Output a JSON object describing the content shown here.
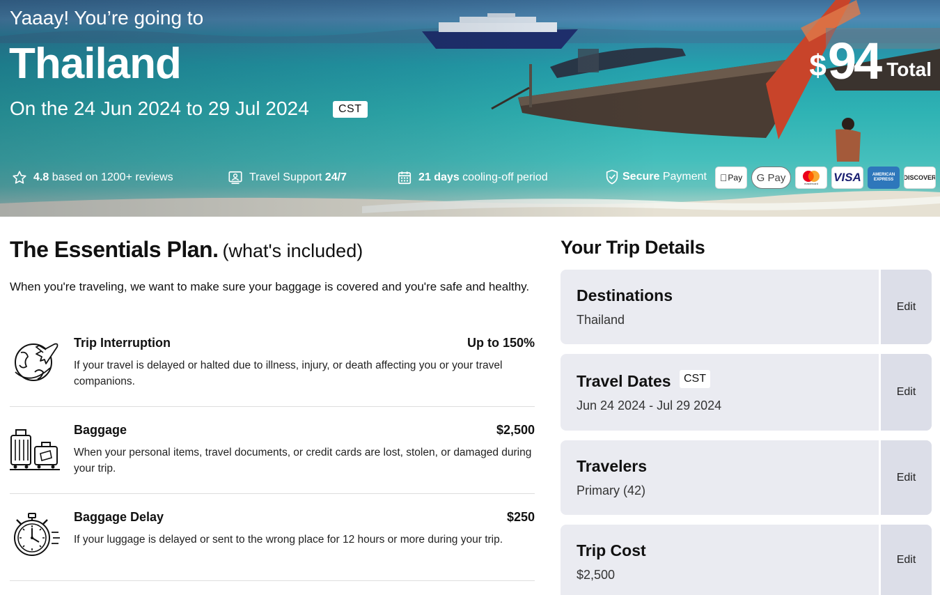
{
  "hero": {
    "kicker": "Yaaay! You’re going to",
    "destination": "Thailand",
    "dates": "On the 24 Jun 2024 to 29 Jul 2024",
    "timezone": "CST",
    "price_currency": "$",
    "price_amount": "94",
    "price_label": "Total",
    "rating": "4.8",
    "rating_text": "based on 1200+ reviews",
    "support_text": "Travel Support",
    "support_hours": "24/7",
    "cooling_days": "21 days",
    "cooling_text": "cooling-off period",
    "secure_strong": "Secure",
    "secure_text": "Payment",
    "payment_methods": [
      "Pay",
      "G Pay",
      "mastercard",
      "VISA",
      "AMERICAN EXPRESS",
      "DISCOVER"
    ],
    "icons": [
      "star-icon",
      "support-icon",
      "calendar-icon",
      "shield-check-icon"
    ]
  },
  "plan": {
    "title": "The Essentials Plan.",
    "subtitle": "(what's included)",
    "intro": "When you're traveling, we want to make sure your baggage is covered and you're safe and healthy.",
    "coverages": [
      {
        "name": "Trip Interruption",
        "amount": "Up to 150%",
        "description": "If your travel is delayed or halted due to illness, injury, or death affecting you or your travel companions.",
        "icon": "globe-plane-icon"
      },
      {
        "name": "Baggage",
        "amount": "$2,500",
        "description": "When your personal items, travel documents, or credit cards are lost, stolen, or damaged during your trip.",
        "icon": "luggage-icon"
      },
      {
        "name": "Baggage Delay",
        "amount": "$250",
        "description": "If your luggage is delayed or sent to the wrong place for 12 hours or more during your trip.",
        "icon": "stopwatch-icon"
      }
    ]
  },
  "trip": {
    "title": "Your Trip Details",
    "edit_label": "Edit",
    "items": [
      {
        "label": "Destinations",
        "value": "Thailand"
      },
      {
        "label": "Travel Dates",
        "value": "Jun 24 2024 - Jul 29 2024",
        "badge": "CST"
      },
      {
        "label": "Travelers",
        "value": "Primary (42)"
      },
      {
        "label": "Trip Cost",
        "value": "$2,500"
      }
    ]
  },
  "colors": {
    "card_bg": "#eaebf1",
    "edit_bg": "#dcdee8",
    "sea": "#2fb3b4"
  }
}
